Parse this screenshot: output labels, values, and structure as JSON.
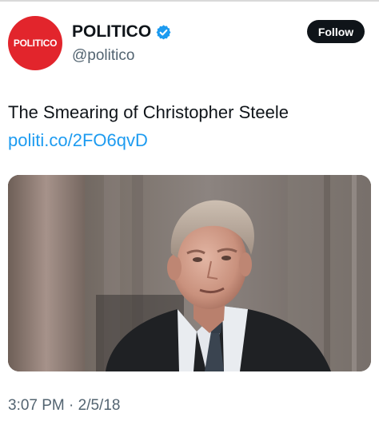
{
  "tweet": {
    "author": {
      "display_name": "POLITICO",
      "handle": "@politico",
      "avatar_logo_text": "POLITICO",
      "verified_icon": "verified-badge-icon"
    },
    "follow_label": "Follow",
    "text": "The Smearing of Christopher Steele",
    "link_text": "politi.co/2FO6qvD",
    "timestamp": "3:07 PM · 2/5/18"
  },
  "colors": {
    "avatar_bg": "#e2252c",
    "link": "#1d9bf0",
    "verified": "#1d9bf0",
    "text_primary": "#0f1419",
    "text_secondary": "#536471",
    "follow_button_bg": "#0f1419"
  }
}
